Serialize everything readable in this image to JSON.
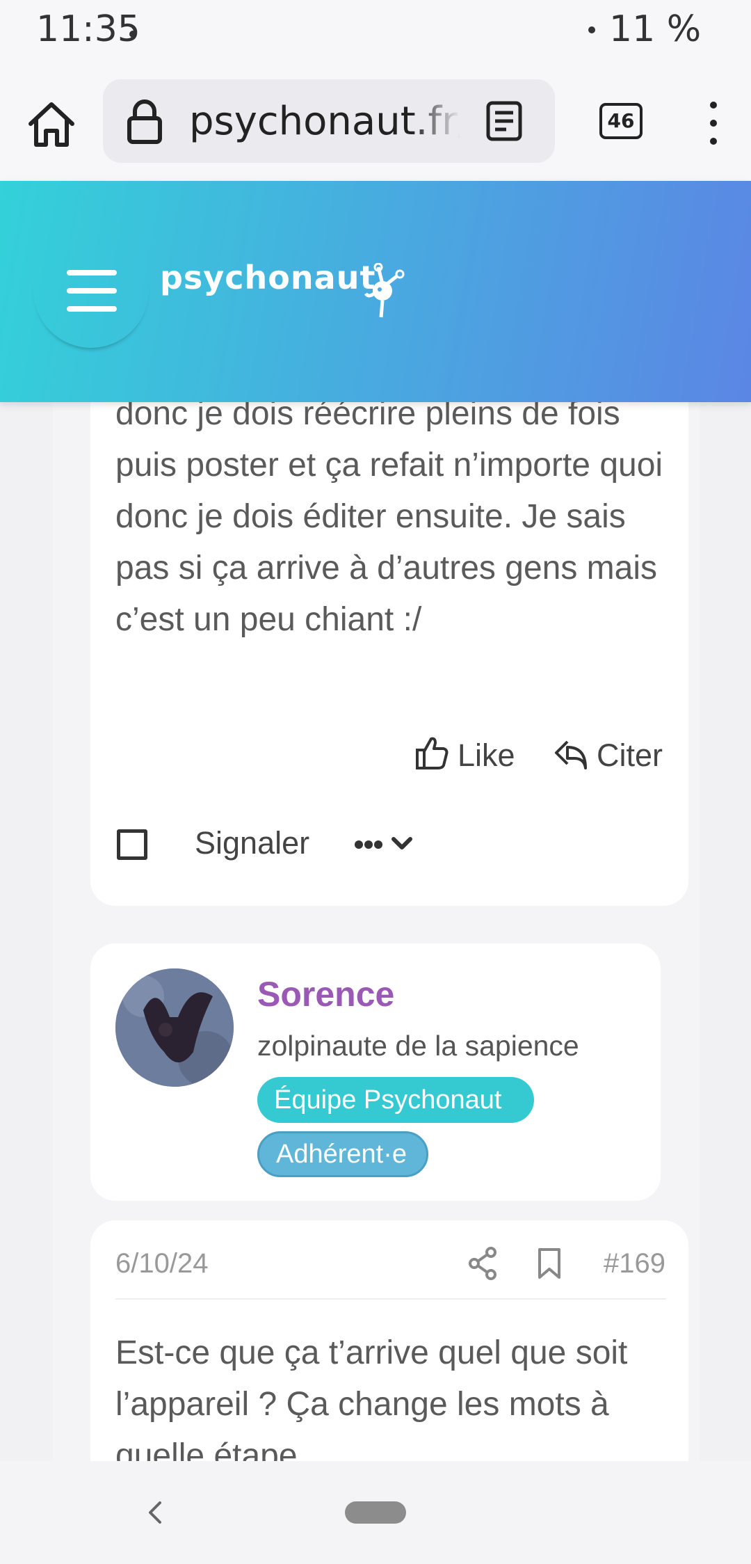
{
  "status_bar": {
    "time": "11:35",
    "battery": "11 %"
  },
  "browser": {
    "url": "psychonaut.fr/",
    "tab_count": "46"
  },
  "site": {
    "logo_text": "psychonaut"
  },
  "post": {
    "text": "donc je dois réécrire pleins de fois puis poster et ça refait n’importe quoi donc je dois éditer ensuite. Je sais pas si ça arrive à d’autres gens mais c’est un peu chiant :/",
    "like_label": "Like",
    "quote_label": "Citer",
    "report_label": "Signaler"
  },
  "author": {
    "name": "Sorence",
    "title": "zolpinaute de la sapience",
    "badges": [
      "Équipe Psychonaut",
      "Adhérent·e"
    ]
  },
  "reply": {
    "date": "6/10/24",
    "number": "#169",
    "text": "Est-ce que ça t’arrive quel que soit l’appareil ? Ça change les mots à quelle étape"
  },
  "colors": {
    "header_gradient_start": "#33d1d9",
    "header_gradient_end": "#5b86e4",
    "author_name": "#9b59b6",
    "badge_team": "#35c9d2",
    "badge_member": "#5fb6d8"
  },
  "icons": [
    "home-icon",
    "lock-icon",
    "reader-mode-icon",
    "tabs-icon",
    "more-vert-icon",
    "hamburger-icon",
    "thumbs-up-icon",
    "reply-icon",
    "checkbox-icon",
    "more-horiz-icon",
    "chevron-down-icon",
    "share-icon",
    "bookmark-icon",
    "back-icon"
  ]
}
